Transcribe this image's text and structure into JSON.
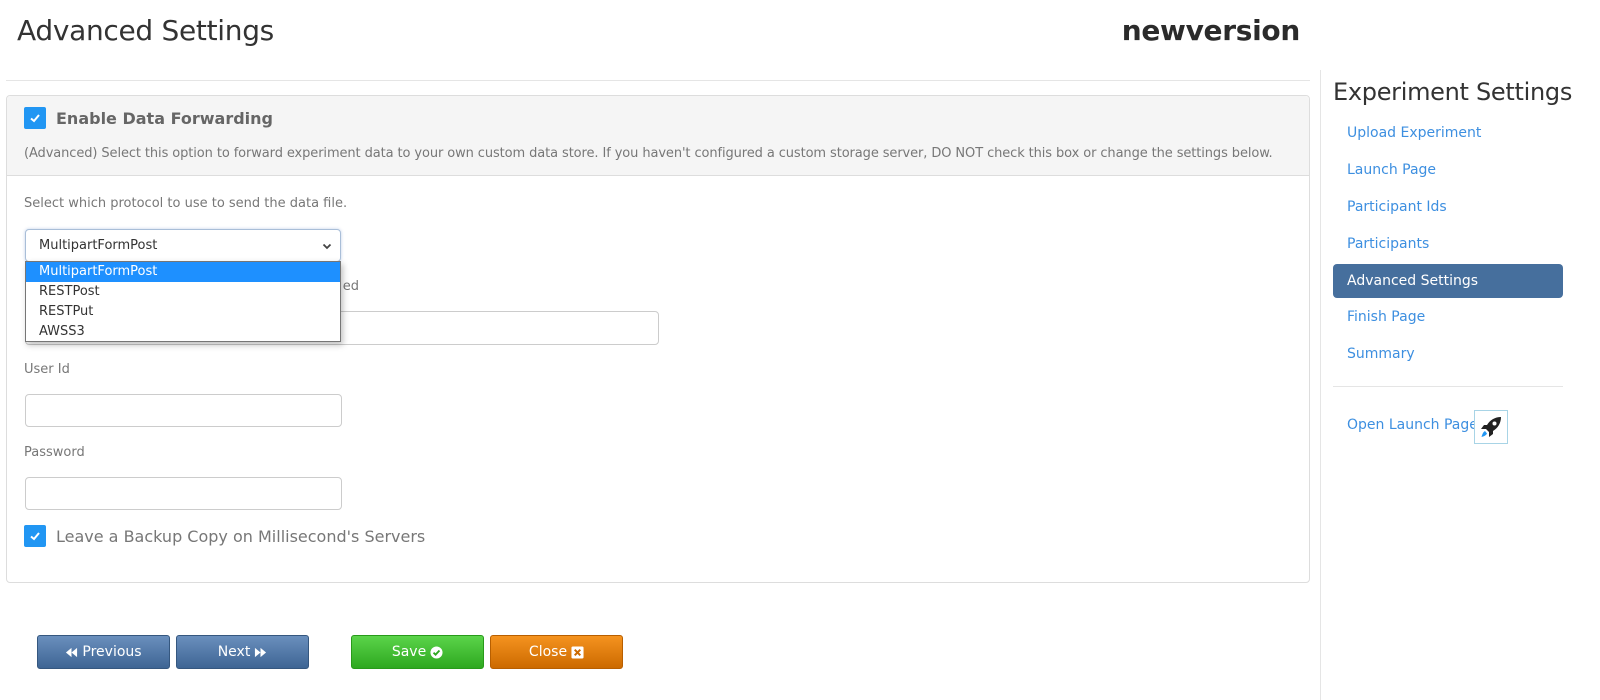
{
  "header": {
    "title": "Advanced Settings",
    "experiment_name": "newversion"
  },
  "panel": {
    "enable_forwarding": {
      "label": "Enable Data Forwarding",
      "checked": true,
      "description": "(Advanced) Select this option to forward experiment data to your own custom data store. If you haven't configured a custom storage server, DO NOT check this box or change the settings below."
    },
    "protocol": {
      "label": "Select which protocol to use to send the data file.",
      "selected": "MultipartFormPost",
      "options": [
        "MultipartFormPost",
        "RESTPost",
        "RESTPut",
        "AWSS3"
      ],
      "dropdown_open": true
    },
    "url_field": {
      "label_visible_fragment": "ed",
      "value": ""
    },
    "user_id": {
      "label": "User Id",
      "value": ""
    },
    "password": {
      "label": "Password",
      "value": ""
    },
    "backup_copy": {
      "label": "Leave a Backup Copy on Millisecond's Servers",
      "checked": true
    }
  },
  "buttons": {
    "previous": "Previous",
    "next": "Next",
    "save": "Save",
    "close": "Close"
  },
  "sidebar": {
    "title": "Experiment Settings",
    "items": [
      {
        "label": "Upload Experiment",
        "active": false
      },
      {
        "label": "Launch Page",
        "active": false
      },
      {
        "label": "Participant Ids",
        "active": false
      },
      {
        "label": "Participants",
        "active": false
      },
      {
        "label": "Advanced Settings",
        "active": true
      },
      {
        "label": "Finish Page",
        "active": false
      },
      {
        "label": "Summary",
        "active": false
      }
    ],
    "open_launch_page": "Open Launch Page",
    "launch_icon": "rocket-icon"
  },
  "colors": {
    "checkbox": "#2196f3",
    "link": "#3d8fe0",
    "nav_active": "#466f9d",
    "option_highlight": "#1e90ff",
    "btn_nav": "#3e6594",
    "btn_save": "#2ea820",
    "btn_close": "#cc6a00"
  }
}
